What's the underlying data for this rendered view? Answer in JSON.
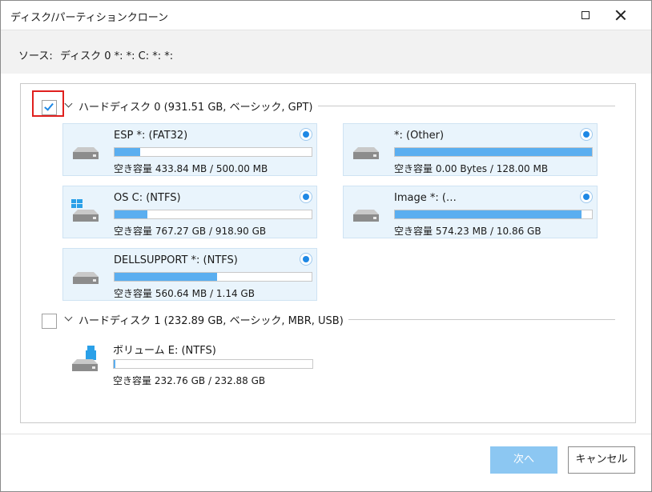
{
  "window": {
    "title": "ディスク/パーティションクローン"
  },
  "source": {
    "label": "ソース:",
    "value": "ディスク 0 *: *: C: *: *:"
  },
  "disks": [
    {
      "label": "ハードディスク 0 (931.51 GB, ベーシック, GPT)",
      "checked": true,
      "partitions": [
        {
          "name": "ESP *: (FAT32)",
          "free": "空き容量 433.84 MB / 500.00 MB",
          "used_fraction": 0.13,
          "selected": true,
          "icon": "hard-drive-icon"
        },
        {
          "name": "*: (Other)",
          "free": "空き容量 0.00 Bytes / 128.00 MB",
          "used_fraction": 1.0,
          "selected": true,
          "icon": "hard-drive-icon"
        },
        {
          "name": "OS C: (NTFS)",
          "free": "空き容量 767.27 GB / 918.90 GB",
          "used_fraction": 0.165,
          "selected": true,
          "icon": "windows-drive-icon"
        },
        {
          "name": "Image *: (…",
          "free": "空き容量 574.23 MB / 10.86 GB",
          "used_fraction": 0.948,
          "selected": true,
          "icon": "hard-drive-icon"
        },
        {
          "name": "DELLSUPPORT *: (NTFS)",
          "free": "空き容量 560.64 MB / 1.14 GB",
          "used_fraction": 0.52,
          "selected": true,
          "icon": "hard-drive-icon"
        }
      ]
    },
    {
      "label": "ハードディスク 1 (232.89 GB, ベーシック, MBR, USB)",
      "checked": false,
      "partitions": [
        {
          "name": "ボリューム E: (NTFS)",
          "free": "空き容量 232.76 GB / 232.88 GB",
          "used_fraction": 0.005,
          "selected": false,
          "icon": "usb-drive-icon"
        }
      ]
    }
  ],
  "buttons": {
    "next": "次へ",
    "cancel": "キャンセル"
  },
  "colors": {
    "accent": "#1e88e5",
    "bar_fill": "#5aaef0",
    "card_bg": "#e9f4fc",
    "next_button_bg": "#8cc7f2",
    "highlight_outline": "#e0201e"
  }
}
